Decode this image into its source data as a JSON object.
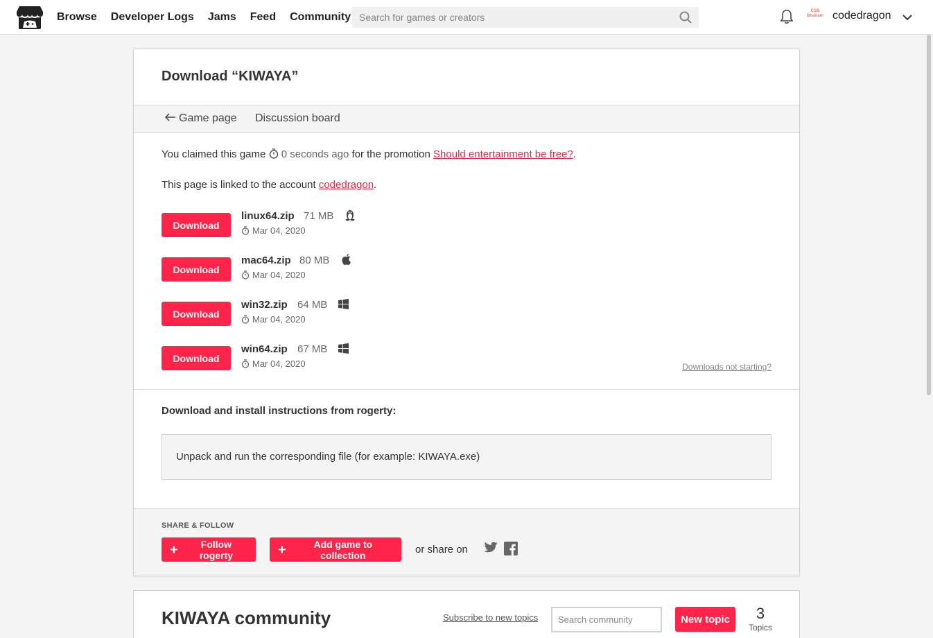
{
  "nav": {
    "items": [
      "Browse",
      "Developer Logs",
      "Jams",
      "Feed",
      "Community"
    ],
    "search_placeholder": "Search for games or creators",
    "avatar_text": "CSB Bhairam",
    "username": "codedragon"
  },
  "page": {
    "title_prefix": "Download “",
    "title_game": "KIWAYA",
    "title_suffix": "”",
    "back_link": "Game page",
    "discussion_link": "Discussion board",
    "claim_prefix": "You claimed this game",
    "claim_ago": "0 seconds ago",
    "claim_mid": "for the promotion",
    "promo_link": "Should entertainment be free?",
    "claim_end": ".",
    "linked_prefix": "This page is linked to the account",
    "linked_account": "codedragon",
    "linked_end": ".",
    "not_starting": "Downloads not starting?"
  },
  "downloads": [
    {
      "button": "Download",
      "file": "linux64.zip",
      "size": "71 MB",
      "os": "linux-icon",
      "date": "Mar 04, 2020"
    },
    {
      "button": "Download",
      "file": "mac64.zip",
      "size": "80 MB",
      "os": "apple-icon",
      "date": "Mar 04, 2020"
    },
    {
      "button": "Download",
      "file": "win32.zip",
      "size": "64 MB",
      "os": "windows-icon",
      "date": "Mar 04, 2020"
    },
    {
      "button": "Download",
      "file": "win64.zip",
      "size": "67 MB",
      "os": "windows-icon",
      "date": "Mar 04, 2020"
    }
  ],
  "instructions": {
    "title": "Download and install instructions from rogerty:",
    "text": "Unpack and run the corresponding file (for example: KIWAYA.exe)"
  },
  "share": {
    "heading": "SHARE & FOLLOW",
    "follow_button": "Follow rogerty",
    "collection_button": "Add game to collection",
    "share_text": "or share on"
  },
  "community": {
    "title": "KIWAYA community",
    "subscribe": "Subscribe to new topics",
    "search_placeholder": "Search community",
    "new_topic": "New topic",
    "topic_count": "3",
    "topic_label": "Topics"
  },
  "colors": {
    "accent": "#ff2449",
    "link": "#da2c49"
  }
}
